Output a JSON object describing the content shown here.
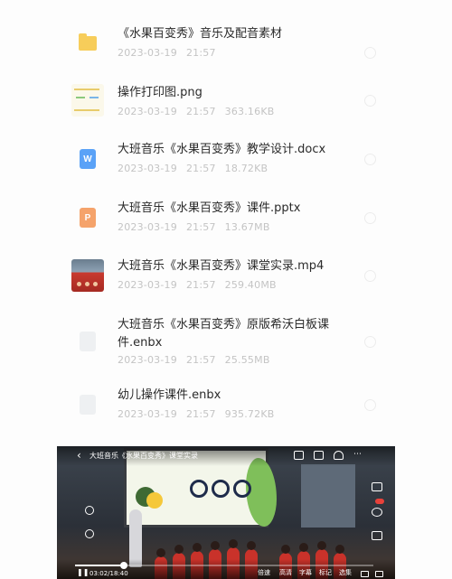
{
  "files": [
    {
      "type": "folder",
      "icon": "folder-icon",
      "name": "《水果百变秀》音乐及配音素材",
      "date": "2023-03-19",
      "time": "21:57",
      "size": ""
    },
    {
      "type": "png",
      "icon": "image-thumbnail",
      "name": "操作打印图.png",
      "date": "2023-03-19",
      "time": "21:57",
      "size": "363.16KB"
    },
    {
      "type": "docx",
      "icon": "word-doc-icon",
      "glyph": "W",
      "name": "大班音乐《水果百变秀》教学设计.docx",
      "date": "2023-03-19",
      "time": "21:57",
      "size": "18.72KB"
    },
    {
      "type": "pptx",
      "icon": "ppt-doc-icon",
      "glyph": "P",
      "name": "大班音乐《水果百变秀》课件.pptx",
      "date": "2023-03-19",
      "time": "21:57",
      "size": "13.67MB"
    },
    {
      "type": "mp4",
      "icon": "video-thumbnail",
      "name": "大班音乐《水果百变秀》课堂实录.mp4",
      "date": "2023-03-19",
      "time": "21:57",
      "size": "259.40MB"
    },
    {
      "type": "enbx",
      "icon": "enbx-doc-icon",
      "name": "大班音乐《水果百变秀》原版希沃白板课件.enbx",
      "date": "2023-03-19",
      "time": "21:57",
      "size": "25.55MB"
    },
    {
      "type": "enbx",
      "icon": "enbx-doc-icon",
      "name": "幼儿操作课件.enbx",
      "date": "2023-03-19",
      "time": "21:57",
      "size": "935.72KB"
    }
  ],
  "player": {
    "title": "大班音乐《水果百变秀》课堂实录",
    "back_icon": "chevron-left-icon",
    "time": "03:02/18:40",
    "progress": 0.163,
    "controls": [
      "倍速",
      "高清",
      "字幕",
      "标记",
      "选集"
    ]
  },
  "colors": {
    "folder": "#f7cd5a",
    "word": "#5aa2f7",
    "ppt": "#f5a36b",
    "meta_text": "#c4c4c4",
    "name_text": "#2a2a2a"
  }
}
